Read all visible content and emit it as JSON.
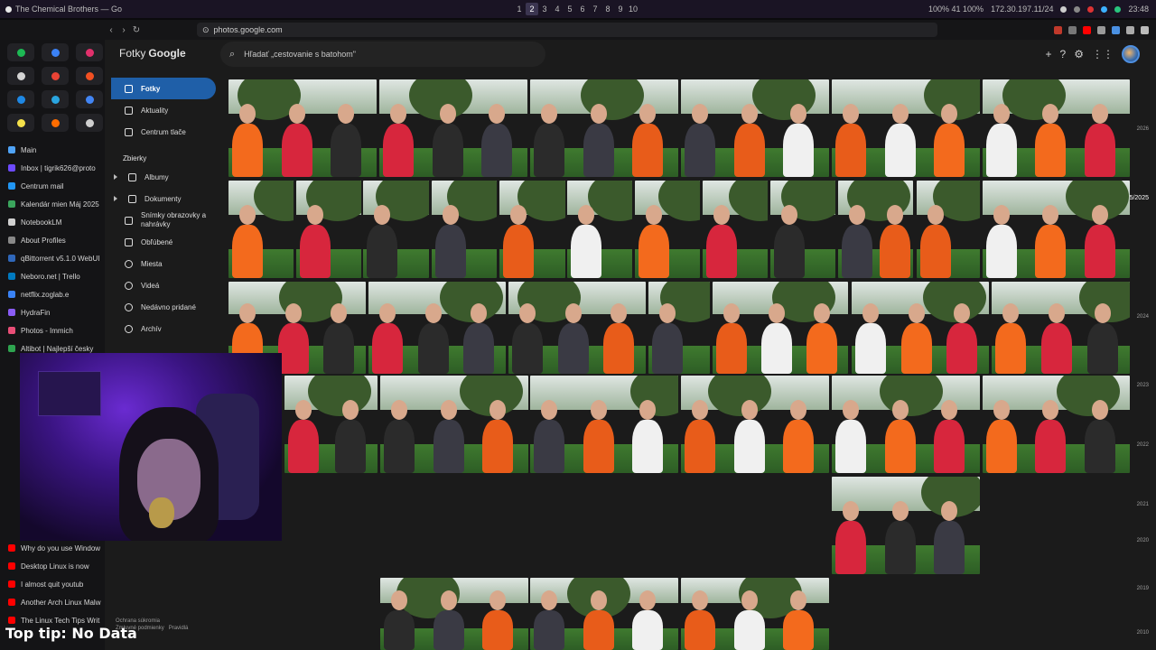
{
  "system_bar": {
    "window_title": "The Chemical Brothers — Go",
    "workspaces": [
      "1",
      "2",
      "3",
      "4",
      "5",
      "6",
      "7",
      "8",
      "9",
      "10"
    ],
    "active_workspace": "2",
    "status_left": "100% 41 100%",
    "ip": "172.30.197.11/24",
    "clock": "23:48"
  },
  "browser": {
    "url": "photos.google.com"
  },
  "vertical_tabs": {
    "pinned_colors": [
      "#1db954",
      "#3b82f6",
      "#e1306c",
      "#d4d4d4",
      "#ea4335",
      "#f25022",
      "#1e88e5",
      "#2aa5e0",
      "#4285f4",
      "#f5e14b",
      "#ff6d00",
      "#cfcfcf"
    ],
    "tabs": [
      {
        "label": "Main",
        "color": "#4fa3f7"
      },
      {
        "label": "Inbox | tigrik626@proto",
        "color": "#6d4aff"
      },
      {
        "label": "Centrum mail",
        "color": "#2196f3"
      },
      {
        "label": "Kalendár mien Máj 2025",
        "color": "#3ba55d"
      },
      {
        "label": "NotebookLM",
        "color": "#d0d0d0"
      },
      {
        "label": "About Profiles",
        "color": "#888888"
      },
      {
        "label": "qBittorrent v5.1.0 WebUI",
        "color": "#2f67ba"
      },
      {
        "label": "Nebo­ro.net | Trello",
        "color": "#0079bf"
      },
      {
        "label": "netflix.zoglab.e",
        "color": "#3a82f6"
      },
      {
        "label": "HydraFin",
        "color": "#8a5cf6"
      },
      {
        "label": "Photos - Immich",
        "color": "#e94e77"
      },
      {
        "label": "Altibot | Najlepší česky",
        "color": "#2ea44f"
      }
    ],
    "bottom_tabs": [
      {
        "label": "Why do you use Window",
        "color": "#ff0000"
      },
      {
        "label": "Desktop Linux is now",
        "color": "#ff0000"
      },
      {
        "label": "I almost quit youtub",
        "color": "#ff0000"
      },
      {
        "label": "Another Arch Linux Malw",
        "color": "#ff0000"
      },
      {
        "label": "The Linux Tech Tips Writ",
        "color": "#ff0000"
      }
    ]
  },
  "photos": {
    "logo_prefix": "Fotky",
    "logo_brand": "Google",
    "search_placeholder": "Hľadať „cestovanie s batohom\"",
    "nav": [
      {
        "label": "Fotky",
        "icon": "photos-icon",
        "active": true
      },
      {
        "label": "Aktuality",
        "icon": "updates-icon",
        "active": false
      },
      {
        "label": "Centrum tlače",
        "icon": "print-icon",
        "active": false
      }
    ],
    "collections_heading": "Zbierky",
    "collections": [
      {
        "label": "Albumy",
        "icon": "album-icon"
      },
      {
        "label": "Dokumenty",
        "icon": "document-icon"
      },
      {
        "label": "Snímky obrazovky a nahrávky",
        "icon": "screenshot-icon"
      },
      {
        "label": "Obľúbené",
        "icon": "star-icon"
      },
      {
        "label": "Miesta",
        "icon": "place-icon"
      },
      {
        "label": "Videá",
        "icon": "video-icon"
      },
      {
        "label": "Nedávno pridané",
        "icon": "recent-icon"
      },
      {
        "label": "Archív",
        "icon": "archive-icon"
      }
    ],
    "footer_privacy": "Ochrana súkromia",
    "footer_terms": "Zmluvné podmienky",
    "footer_rules": "Pravidlá",
    "timeline_current": "5/2025",
    "timeline_years": [
      "2026",
      "2024",
      "2023",
      "2022",
      "2021",
      "2020",
      "2019",
      "2010"
    ]
  },
  "overlay": {
    "tip": "Top tip: No Data"
  }
}
